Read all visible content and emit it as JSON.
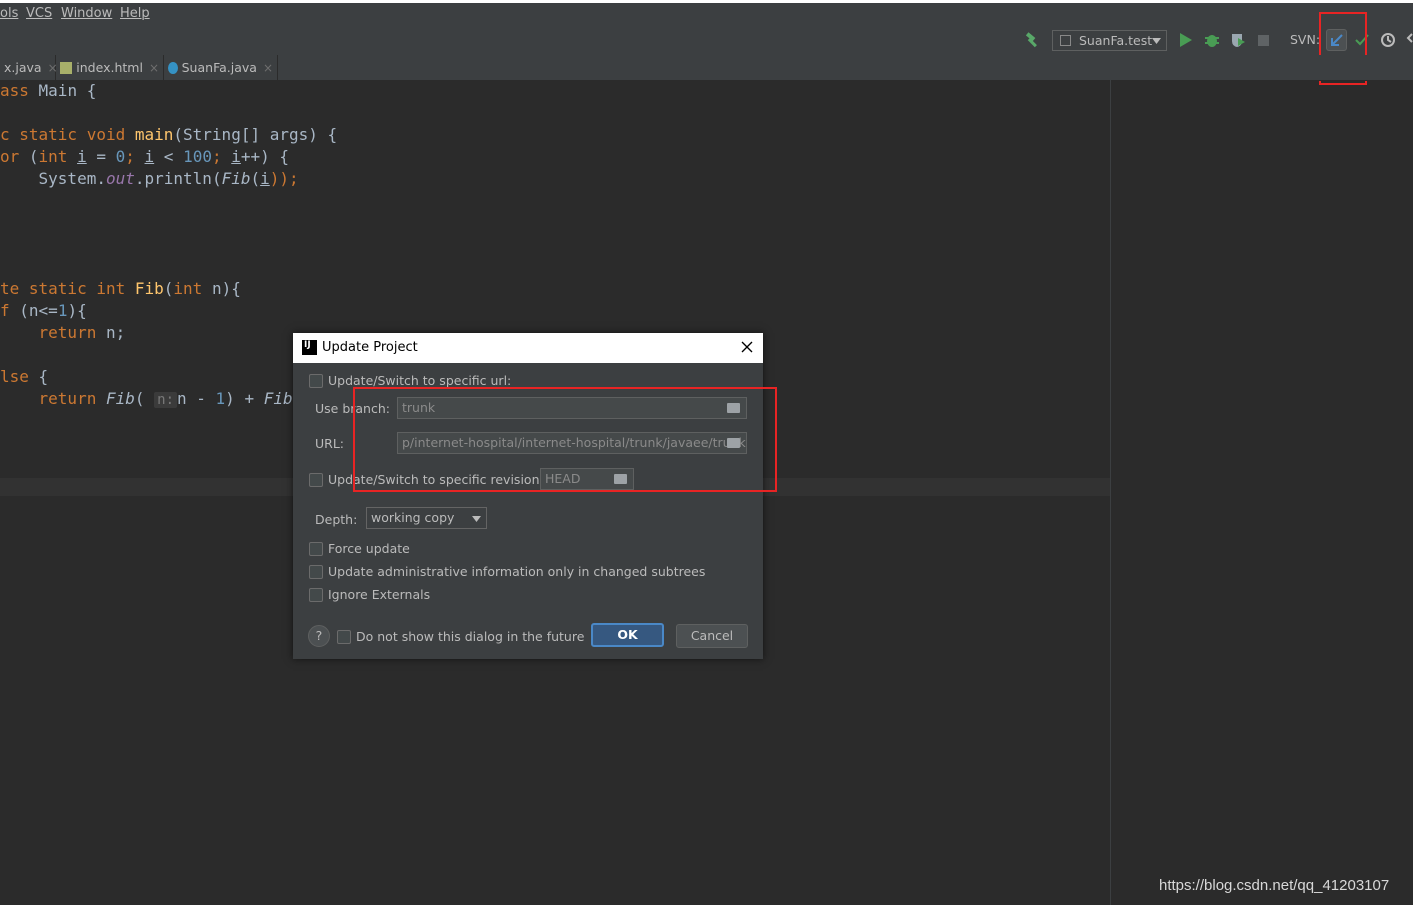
{
  "menubar": {
    "items": [
      "ols",
      "VCS",
      "Window",
      "Help"
    ]
  },
  "toolbar": {
    "run_config": "SuanFa.test",
    "svn_label": "SVN:",
    "icons": [
      "hammer-icon",
      "play-icon",
      "debug-icon",
      "coverage-icon",
      "stop-icon",
      "svn-update-icon",
      "svn-commit-icon",
      "history-icon"
    ]
  },
  "tabs": [
    {
      "label": "x.java"
    },
    {
      "label": "index.html"
    },
    {
      "label": "SuanFa.java"
    }
  ],
  "editor": {
    "line1": {
      "kw": "ass",
      "rest": " Main {"
    },
    "line2": {
      "a": "c static void ",
      "fn": "main",
      "b": "(String[] args) {"
    },
    "line3": {
      "kw1": "or",
      "a": " (",
      "kw2": "int",
      "v1": "i",
      "b": " = ",
      "n0": "0",
      "c": "; ",
      "v2": "i",
      "d": " < ",
      "n100": "100",
      "e": "; ",
      "v3": "i",
      "f": "++) {"
    },
    "line4": {
      "a": "    System.",
      "field": "out",
      "b": ".println(",
      "fib": "Fib",
      "c": "(",
      "v": "i",
      "d": "));"
    },
    "line5": {
      "kw": "te static int ",
      "fn": "Fib",
      "a": "(",
      "kw2": "int",
      "b": " n){"
    },
    "line6": {
      "kw": "f",
      "a": " (n<=",
      "n1": "1",
      "b": "){"
    },
    "line7": {
      "kw": "    return",
      "a": " n;"
    },
    "line8": {
      "kw": "lse",
      "a": " {"
    },
    "line9": {
      "kw": "    return ",
      "fib": "Fib",
      "a": "( ",
      "hint": "n:",
      "b": "n - ",
      "n1": "1",
      "c": ") + ",
      "fib2": "Fib("
    }
  },
  "dialog": {
    "title": "Update Project",
    "switch_url_label": "Update/Switch to specific url:",
    "use_branch_label": "Use branch:",
    "use_branch_value": "trunk",
    "url_label": "URL:",
    "url_value": "p/internet-hospital/internet-hospital/trunk/javaee/trunk",
    "switch_revision_label": "Update/Switch to specific revision:",
    "revision_value": "HEAD",
    "depth_label": "Depth:",
    "depth_value": "working copy",
    "force_update": "Force update",
    "update_admin": "Update administrative information only in changed subtrees",
    "ignore_externals": "Ignore Externals",
    "help": "?",
    "dont_show": "Do not show this dialog in the future",
    "ok": "OK",
    "cancel": "Cancel"
  },
  "watermark": "https://blog.csdn.net/qq_41203107",
  "colors": {
    "annotation_red": "#e82424",
    "accent_blue": "#4a88c7",
    "background": "#2b2b2b"
  }
}
